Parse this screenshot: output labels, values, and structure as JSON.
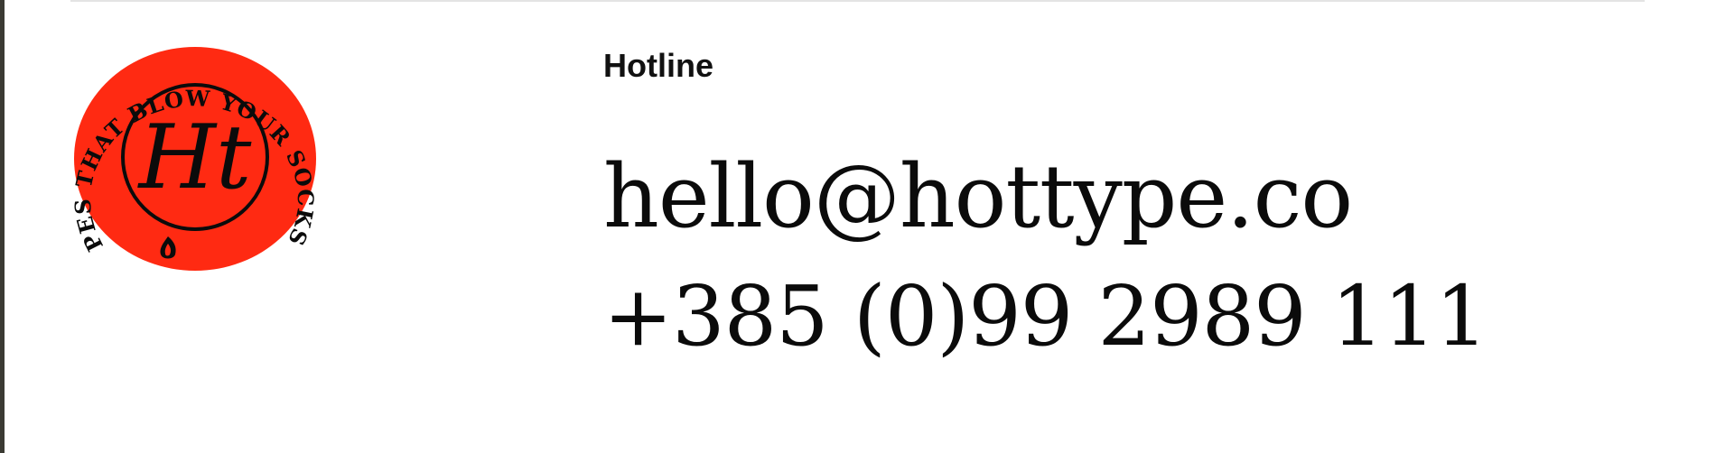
{
  "colors": {
    "badge_fill": "#ff2a12",
    "ink": "#0b0b0b",
    "edge_bar": "#3b3a33",
    "divider": "#e4e4e4"
  },
  "badge": {
    "ring_text": "SHAPES THAT BLOW YOUR SOCKS OFF",
    "monogram": "Ht",
    "icon": "flame-icon"
  },
  "hotline": {
    "label": "Hotline",
    "email": "hello@hottype.co",
    "phone": "+385 (0)99 2989 111"
  }
}
